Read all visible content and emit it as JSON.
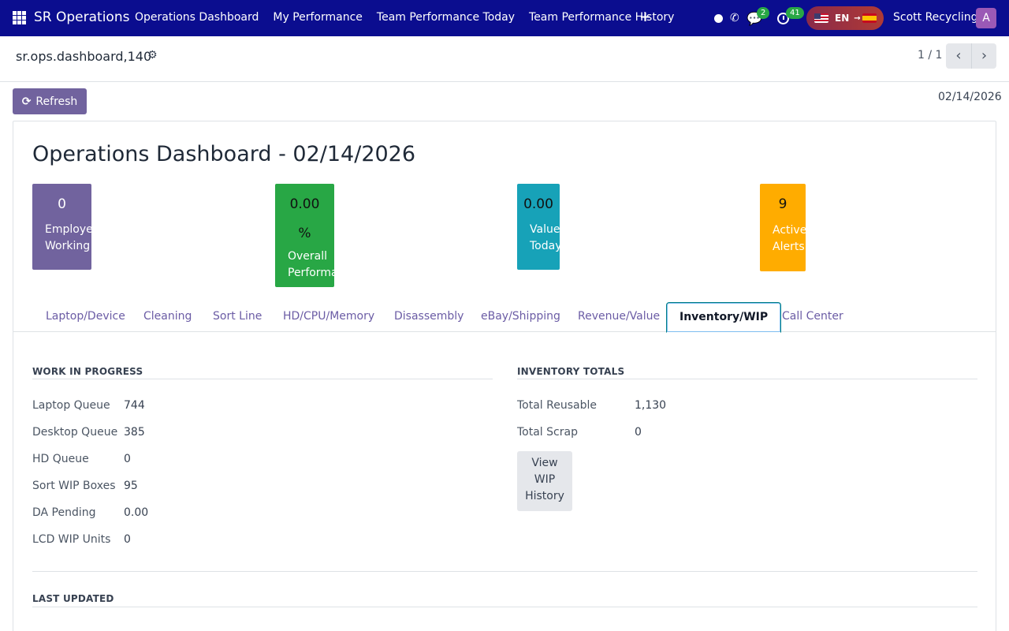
{
  "navbar": {
    "brand": "SR Operations",
    "menu": [
      "Operations Dashboard",
      "My Performance",
      "Team Performance Today",
      "Team Performance History"
    ],
    "plus_symbol": "+",
    "chat_badge": "2",
    "activity_badge": "41",
    "language_code": "EN",
    "user_name": "Scott Recycling",
    "avatar_letter": "A",
    "colors": {
      "navbar_bg": "#0b0d8f",
      "badge": "#28a745"
    }
  },
  "control": {
    "record_name": "sr.ops.dashboard,140",
    "pager": "1 / 1"
  },
  "toolbar": {
    "refresh_label": "Refresh",
    "date": "02/14/2026"
  },
  "dashboard": {
    "title": "Operations Dashboard - 02/14/2026",
    "kpis": [
      {
        "value": "0",
        "label_lines": [
          "Employees",
          "Working"
        ],
        "color": "#71639e"
      },
      {
        "value": "0.00",
        "value_line2": "%",
        "label_lines": [
          "Overall",
          "Performance"
        ],
        "color": "#28a745"
      },
      {
        "value": "0.00",
        "label_lines": [
          "Value",
          "Today"
        ],
        "color": "#17a2b8"
      },
      {
        "value": "9",
        "label_lines": [
          "Active",
          "Alerts"
        ],
        "color": "#ffac00"
      }
    ],
    "tabs": [
      "Laptop/Device",
      "Cleaning",
      "Sort Line",
      "HD/CPU/Memory",
      "Disassembly",
      "eBay/Shipping",
      "Revenue/Value",
      "Inventory/WIP",
      "Call Center"
    ],
    "active_tab": "Inventory/WIP",
    "wip": {
      "heading": "WORK IN PROGRESS",
      "fields": [
        {
          "label": "Laptop Queue",
          "value": "744"
        },
        {
          "label": "Desktop Queue",
          "value": "385"
        },
        {
          "label": "HD Queue",
          "value": "0"
        },
        {
          "label": "Sort WIP Boxes",
          "value": "95"
        },
        {
          "label": "DA Pending",
          "value": "0.00"
        },
        {
          "label": "LCD WIP Units",
          "value": "0"
        }
      ]
    },
    "inventory": {
      "heading": "INVENTORY TOTALS",
      "fields": [
        {
          "label": "Total Reusable",
          "value": "1,130"
        },
        {
          "label": "Total Scrap",
          "value": "0"
        }
      ],
      "button_lines": [
        "View",
        "WIP",
        "History"
      ]
    },
    "last_updated": {
      "heading": "LAST UPDATED"
    }
  }
}
